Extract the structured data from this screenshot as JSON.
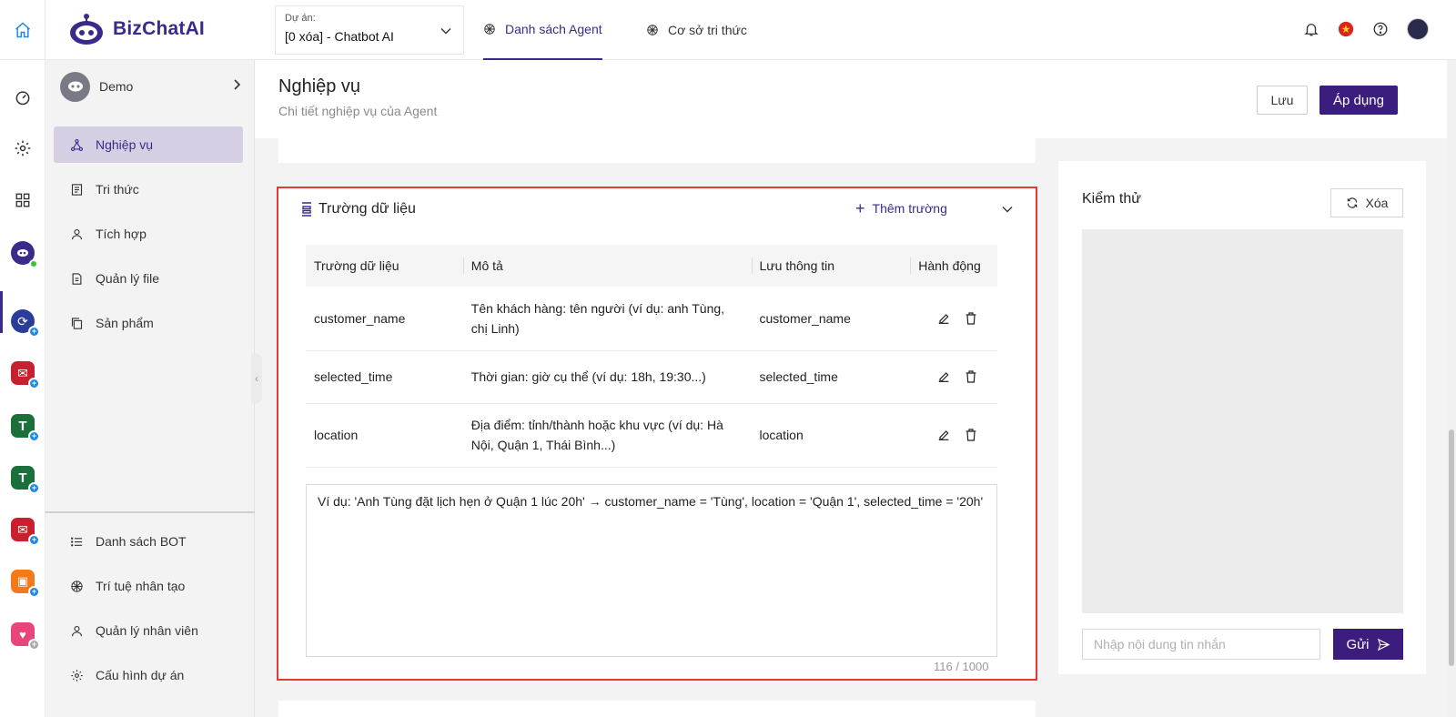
{
  "brand": {
    "name": "BizChatAI",
    "color": "#3b2a8c"
  },
  "project": {
    "label": "Dự án:",
    "value": "[0 xóa] - Chatbot AI"
  },
  "top_tabs": [
    {
      "label": "Danh sách Agent",
      "active": true
    },
    {
      "label": "Cơ sở tri thức",
      "active": false
    }
  ],
  "bot": {
    "name": "Demo"
  },
  "sidebar": {
    "items": [
      {
        "label": "Nghiệp vụ",
        "icon": "network-icon",
        "active": true
      },
      {
        "label": "Tri thức",
        "icon": "book-icon"
      },
      {
        "label": "Tích hợp",
        "icon": "user-icon"
      },
      {
        "label": "Quản lý file",
        "icon": "file-icon"
      },
      {
        "label": "Sản phẩm",
        "icon": "copy-icon"
      }
    ],
    "bottom_items": [
      {
        "label": "Danh sách BOT",
        "icon": "list-icon"
      },
      {
        "label": "Trí tuệ nhân tạo",
        "icon": "ai-icon"
      },
      {
        "label": "Quản lý nhân viên",
        "icon": "user-icon"
      },
      {
        "label": "Cấu hình dự án",
        "icon": "gear-icon"
      }
    ]
  },
  "header": {
    "title": "Nghiệp vụ",
    "subtitle": "Chi tiết nghiệp vụ của Agent",
    "save_label": "Lưu",
    "apply_label": "Áp dụng"
  },
  "fields_card": {
    "title": "Trường dữ liệu",
    "add_label": "Thêm trường",
    "columns": [
      "Trường dữ liệu",
      "Mô tả",
      "Lưu thông tin",
      "Hành động"
    ],
    "rows": [
      {
        "field": "customer_name",
        "desc": "Tên khách hàng: tên người (ví dụ: anh Tùng, chị Linh)",
        "store": "customer_name"
      },
      {
        "field": "selected_time",
        "desc": "Thời gian: giờ cụ thể (ví dụ: 18h, 19:30...)",
        "store": "selected_time"
      },
      {
        "field": "location",
        "desc": "Địa điểm: tỉnh/thành hoặc khu vực (ví dụ: Hà Nội, Quận 1, Thái Bình...)",
        "store": "location"
      }
    ],
    "example": "Ví dụ: 'Anh Tùng đặt lịch hẹn ở Quận 1 lúc 20h' → customer_name = 'Tùng', location = 'Quận 1', selected_time = '20h'",
    "char_count": "116 / 1000"
  },
  "test_panel": {
    "title": "Kiểm thử",
    "clear_label": "Xóa",
    "input_placeholder": "Nhập nội dung tin nhắn",
    "send_label": "Gửi"
  },
  "colors": {
    "accent": "#3b1d7e",
    "highlight_border": "#e53935",
    "active_bg": "#d6cfe3"
  }
}
